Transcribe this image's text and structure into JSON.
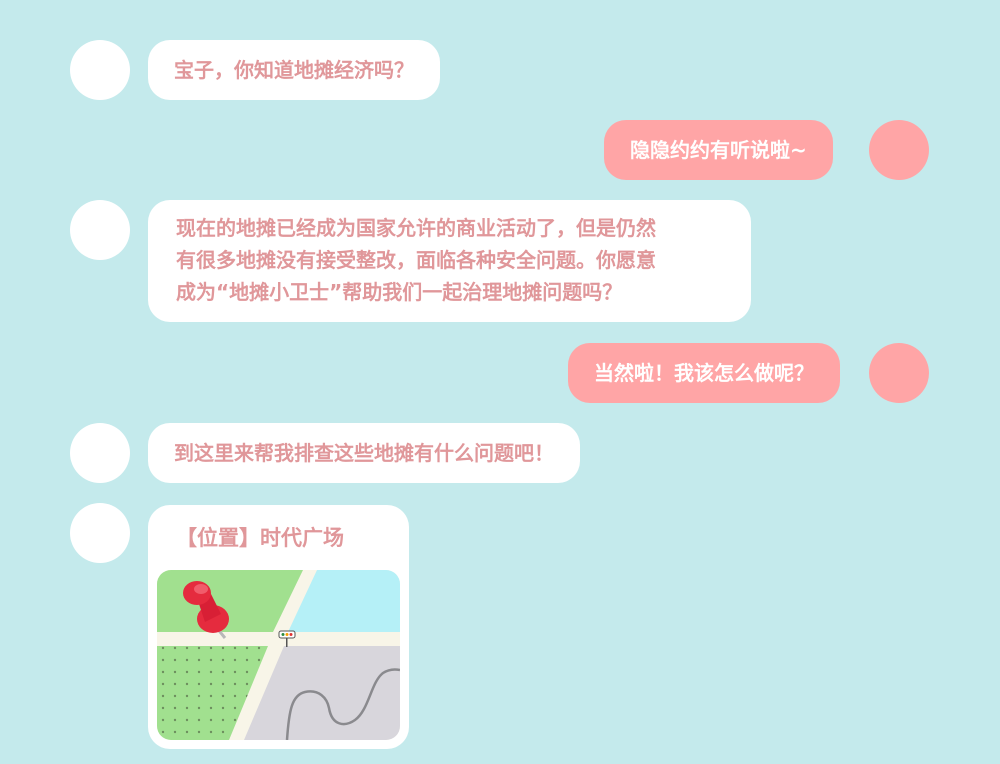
{
  "messages": [
    {
      "side": "left",
      "text": "宝子，你知道地摊经济吗？"
    },
    {
      "side": "right",
      "text": "隐隐约约有听说啦~"
    },
    {
      "side": "left",
      "lines": [
        "现在的地摊已经成为国家允许的商业活动了，但是仍然",
        "有很多地摊没有接受整改，面临各种安全问题。你愿意",
        "成为“地摊小卫士”帮助我们一起治理地摊问题吗？"
      ]
    },
    {
      "side": "right",
      "text": "当然啦！我该怎么做呢？"
    },
    {
      "side": "left",
      "text": "到这里来帮我排查这些地摊有什么问题吧！"
    }
  ],
  "location_card": {
    "label": "【位置】时代广场",
    "map_icon": "map-thumbnail",
    "pin_icon": "red-pushpin-icon"
  },
  "colors": {
    "background": "#c4eaec",
    "left_bubble": "#ffffff",
    "left_text": "#e0979a",
    "right_bubble": "#ffa5a6",
    "right_text": "#ffffff"
  }
}
